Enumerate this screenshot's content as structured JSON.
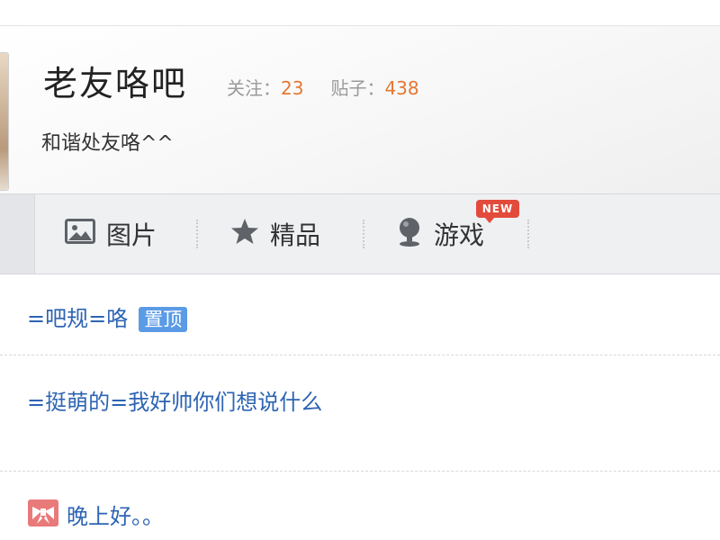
{
  "forum": {
    "title": "老友咯吧",
    "follow_label": "关注：",
    "follow_count": "23",
    "posts_label": "贴子：",
    "posts_count": "438",
    "slogan": "和谐处友咯^^"
  },
  "nav": {
    "items": [
      {
        "label": "图片",
        "icon": "image-icon"
      },
      {
        "label": "精品",
        "icon": "star-icon"
      },
      {
        "label": "游戏",
        "icon": "game-icon"
      }
    ],
    "new_badge": "NEW"
  },
  "threads": [
    {
      "title": "=吧规=咯",
      "tag": "置顶"
    },
    {
      "title": "=挺萌的=我好帅你们想说什么"
    },
    {
      "title": "晚上好。。",
      "icon": "bow-icon"
    }
  ],
  "colors": {
    "accent_number": "#e47833",
    "link_blue": "#2d64b3",
    "pin_tag": "#5b9be6",
    "badge_red": "#e24b3b"
  }
}
